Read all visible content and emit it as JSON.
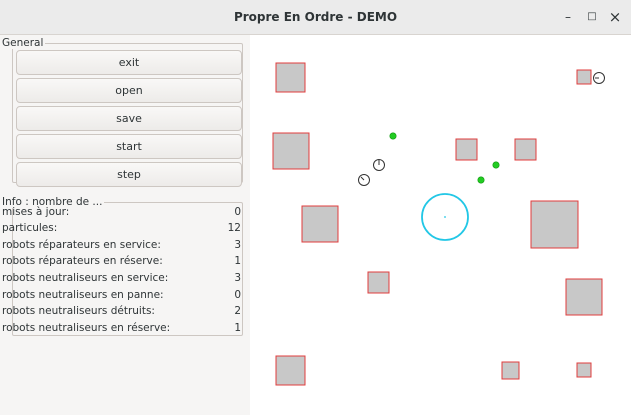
{
  "window": {
    "title": "Propre En Ordre - DEMO",
    "minimize": "–",
    "maximize": "□",
    "close": "×"
  },
  "general": {
    "label": "General",
    "buttons": [
      "exit",
      "open",
      "save",
      "start",
      "step"
    ]
  },
  "info": {
    "label": "Info : nombre de ...",
    "rows": [
      {
        "label": "mises à jour:",
        "value": "0"
      },
      {
        "label": "particules:",
        "value": "12"
      },
      {
        "label": "robots réparateurs en service:",
        "value": "3"
      },
      {
        "label": "robots réparateurs en réserve:",
        "value": "1"
      },
      {
        "label": "robots neutraliseurs en service:",
        "value": "3"
      },
      {
        "label": "robots neutraliseurs en panne:",
        "value": "0"
      },
      {
        "label": "robots neutraliseurs détruits:",
        "value": "2"
      },
      {
        "label": "robots neutraliseurs en réserve:",
        "value": "1"
      }
    ]
  },
  "colors": {
    "particle_fill": "#c8c8c8",
    "particle_border": "#e03c3c",
    "repair_robot": "#22cc22",
    "neutralizer_stroke": "#333333",
    "spatial_ring": "#22c7e6"
  }
}
